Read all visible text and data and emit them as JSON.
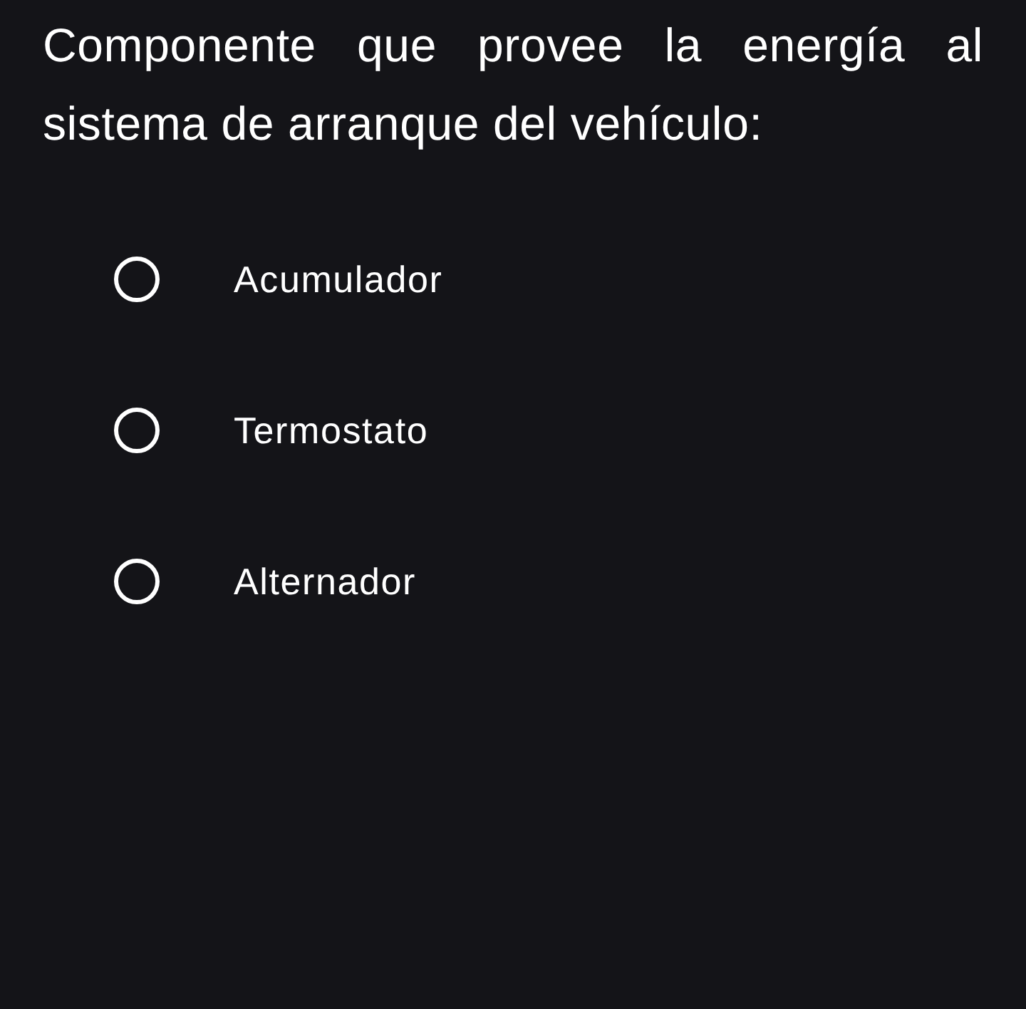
{
  "question": "Componente que provee la energía al sistema de arranque del vehículo:",
  "options": [
    {
      "label": "Acumulador",
      "selected": false
    },
    {
      "label": "Termostato",
      "selected": false
    },
    {
      "label": "Alternador",
      "selected": false
    }
  ]
}
